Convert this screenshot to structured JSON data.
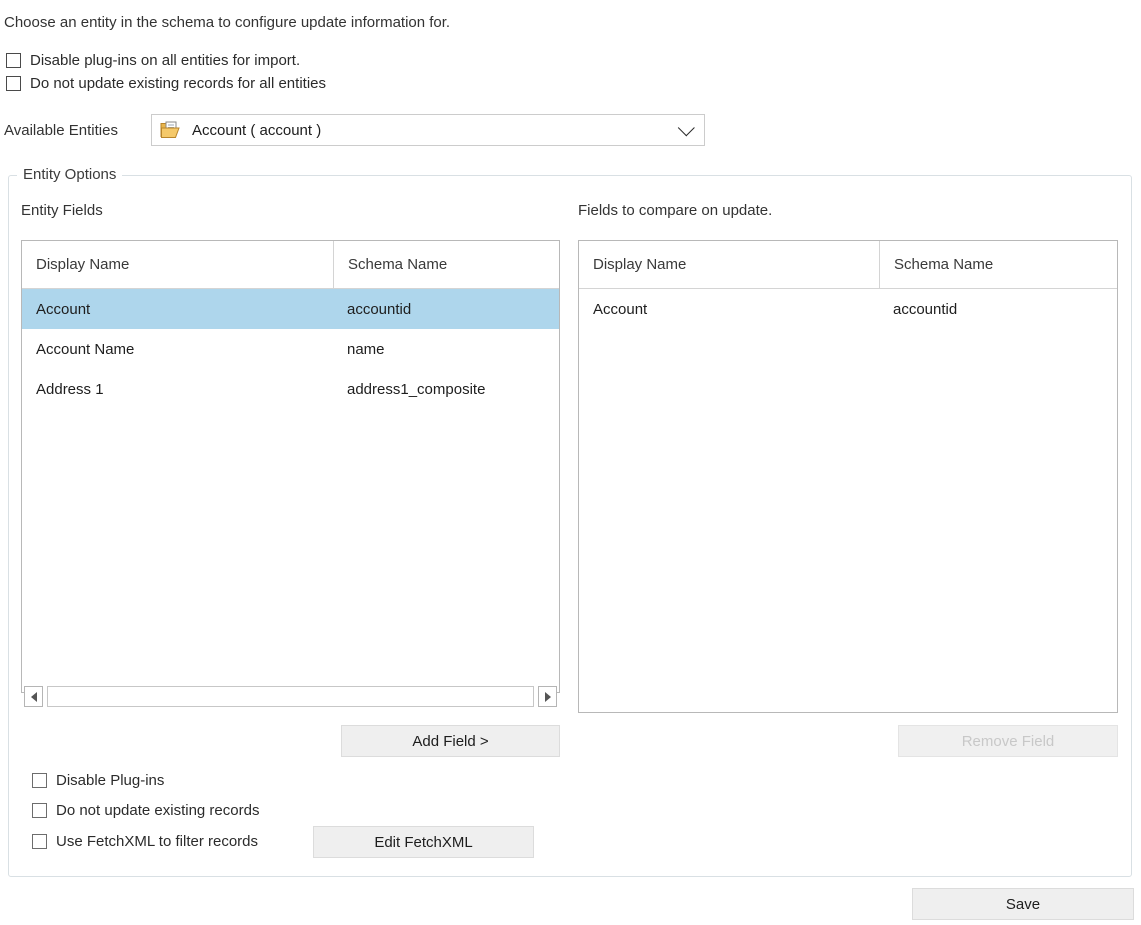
{
  "intro": {
    "text": "Choose an entity in the schema to configure update information for."
  },
  "global_options": [
    {
      "label": "Disable plug-ins on all entities for import.",
      "checked": false
    },
    {
      "label": "Do not update existing records for all entities",
      "checked": false
    }
  ],
  "entity_selector": {
    "label": "Available Entities",
    "icon": "folder-document-icon",
    "selected": "Account  ( account )",
    "arrow_icon": "chevron-down-icon"
  },
  "group": {
    "title": "Entity Options"
  },
  "left_panel": {
    "heading": "Entity Fields",
    "columns": [
      "Display Name",
      "Schema Name"
    ],
    "rows": [
      {
        "display_name": "Account",
        "schema_name": "accountid",
        "selected": true
      },
      {
        "display_name": "Account Name",
        "schema_name": "name",
        "selected": false
      },
      {
        "display_name": "Address 1",
        "schema_name": "address1_composite",
        "selected": false
      }
    ],
    "scrollbar": {
      "left_arrow_icon": "triangle-left-icon",
      "right_arrow_icon": "triangle-right-icon"
    },
    "add_button": {
      "label": "Add Field >",
      "enabled": true
    }
  },
  "right_panel": {
    "heading": "Fields to compare on update.",
    "columns": [
      "Display Name",
      "Schema Name"
    ],
    "rows": [
      {
        "display_name": "Account",
        "schema_name": "accountid",
        "selected": false
      }
    ],
    "remove_button": {
      "label": "Remove Field",
      "enabled": false
    }
  },
  "entity_options": [
    {
      "label": "Disable Plug-ins",
      "checked": false
    },
    {
      "label": "Do not update existing records",
      "checked": false
    },
    {
      "label": "Use FetchXML to filter records",
      "checked": false
    }
  ],
  "fetchxml_button": {
    "label": "Edit FetchXML",
    "enabled": true
  },
  "save_button": {
    "label": "Save",
    "enabled": true
  },
  "colors": {
    "selection": "#aed6ec",
    "button_face": "#efefef",
    "grid_border": "#b8b8b8",
    "group_border": "#d9e0e4",
    "disabled_text": "#c8c8c8"
  }
}
